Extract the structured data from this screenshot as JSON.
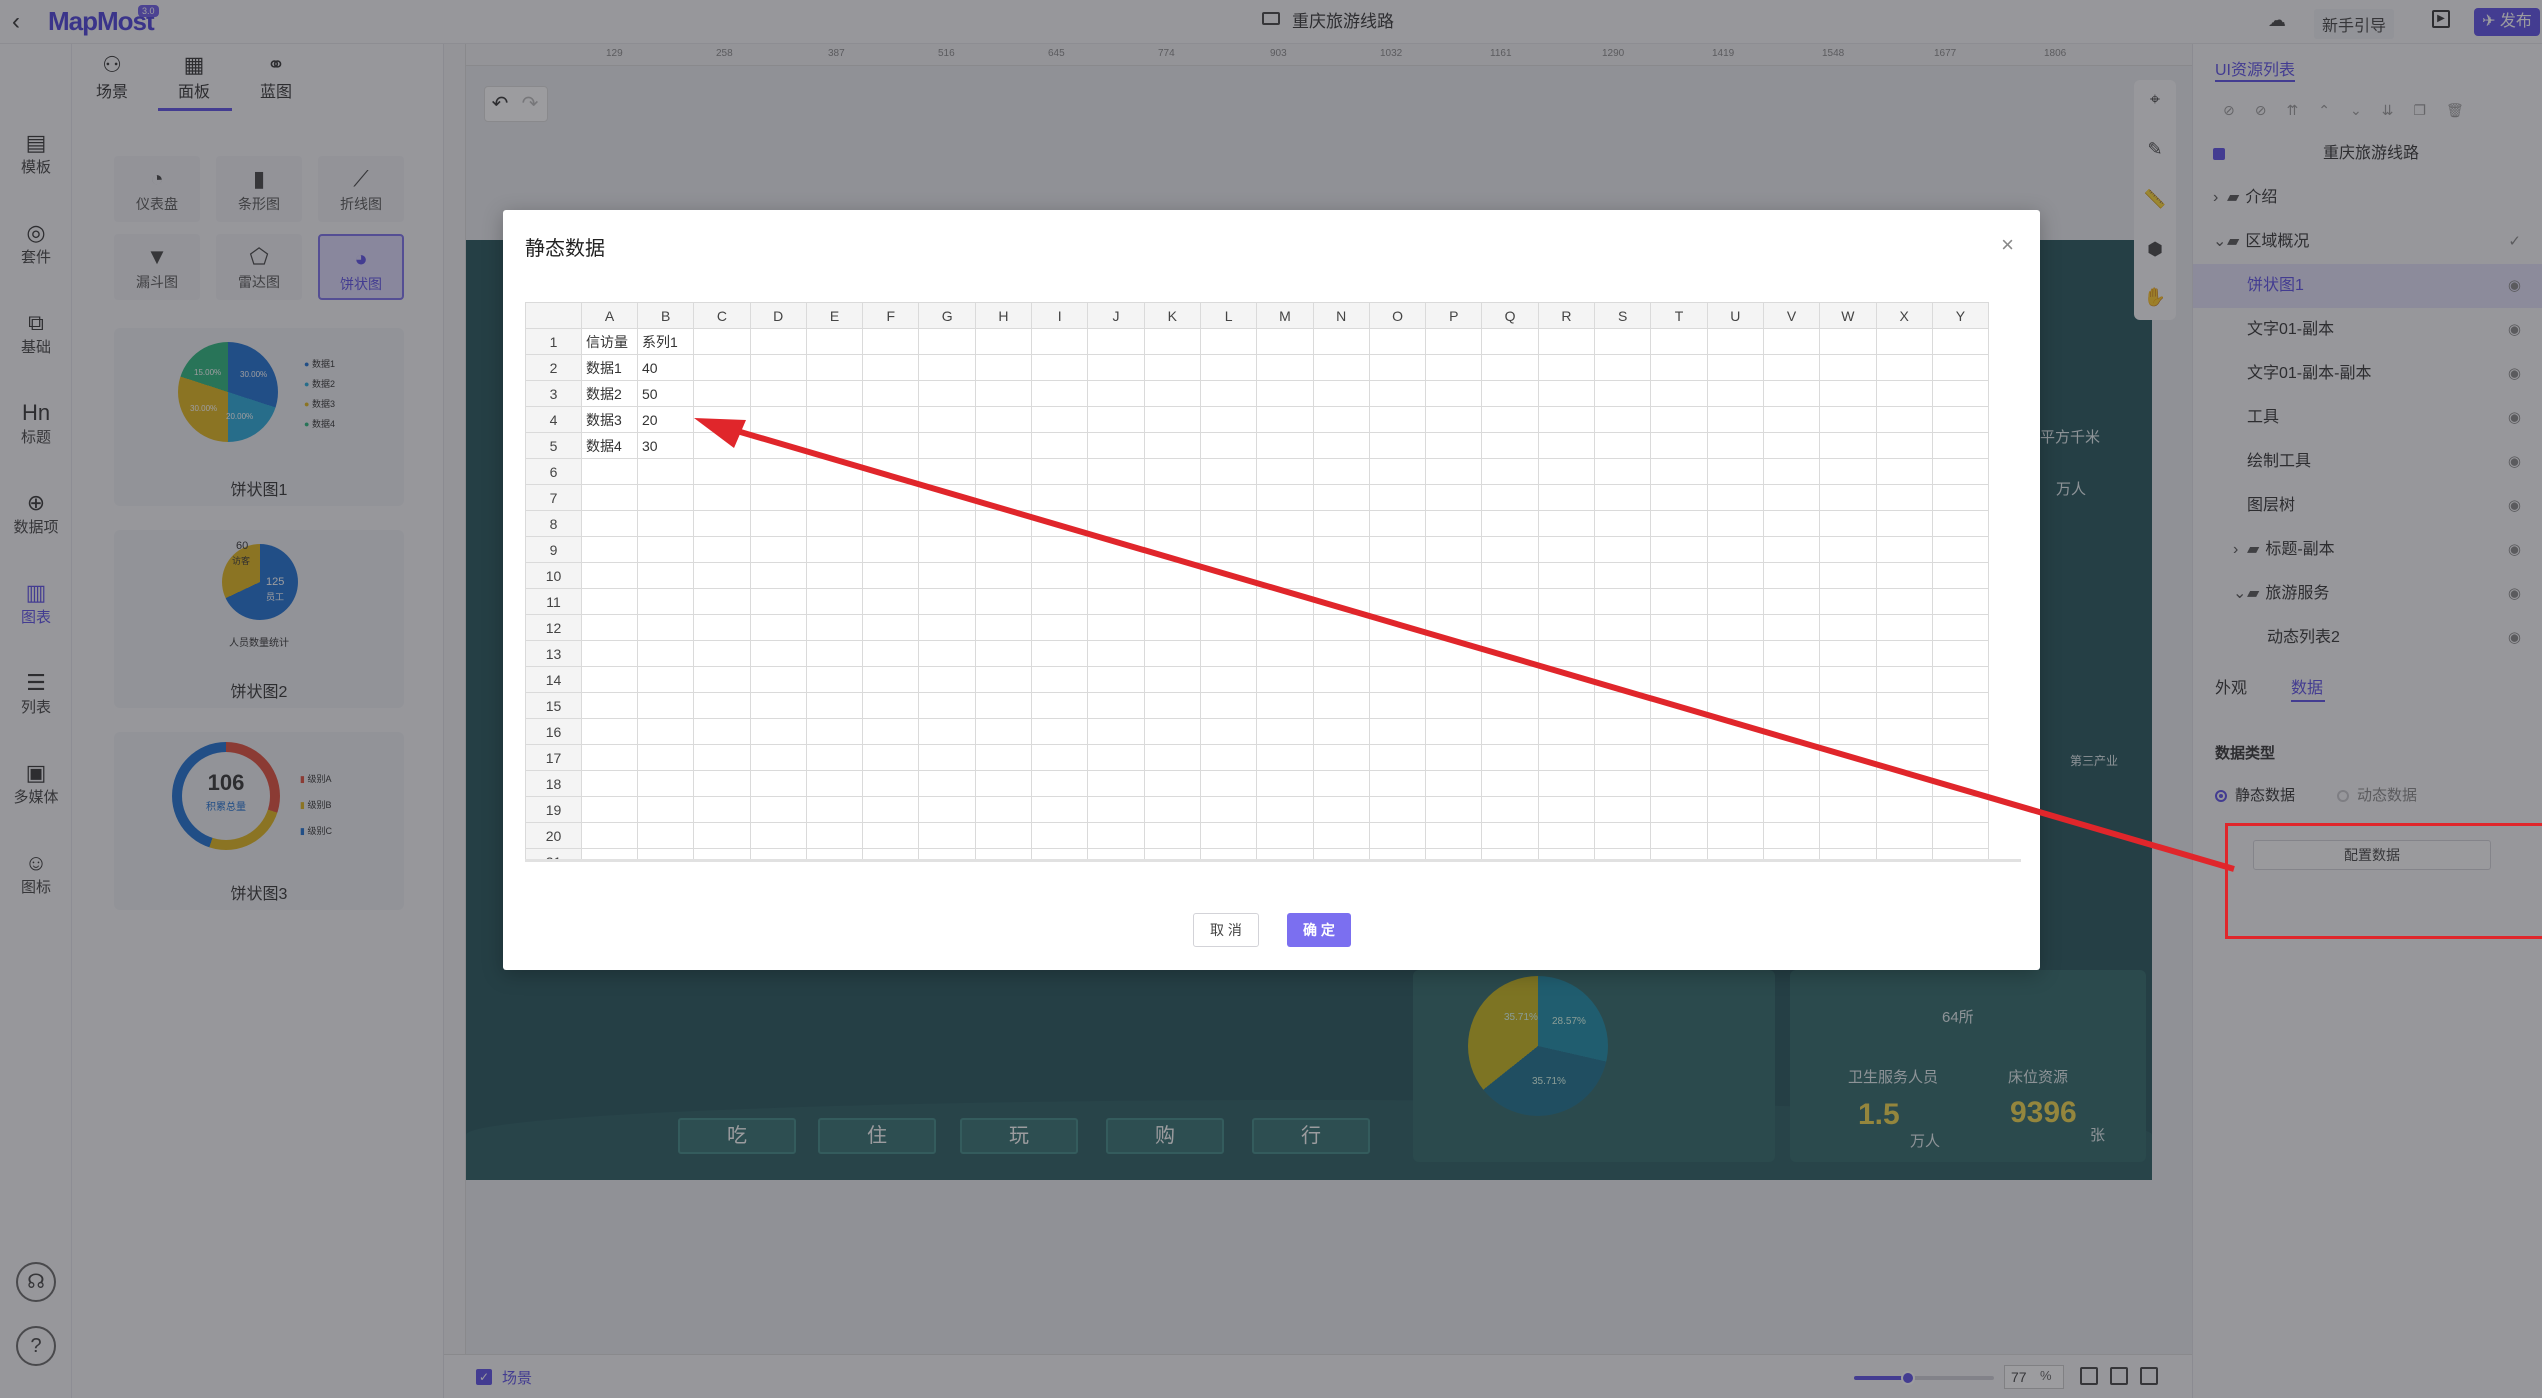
{
  "app": {
    "logo": "MapMost",
    "badge": "3.0",
    "title": "重庆旅游线路",
    "guide": "新手引导",
    "publish": "发布"
  },
  "leftnav": [
    {
      "label": "模板",
      "icon": "template-icon"
    },
    {
      "label": "套件",
      "icon": "kit-icon"
    },
    {
      "label": "基础",
      "icon": "basic-icon"
    },
    {
      "label": "标题",
      "icon": "title-icon"
    },
    {
      "label": "数据项",
      "icon": "data-item-icon"
    },
    {
      "label": "图表",
      "icon": "chart-icon"
    },
    {
      "label": "列表",
      "icon": "list-icon"
    },
    {
      "label": "多媒体",
      "icon": "media-icon"
    },
    {
      "label": "图标",
      "icon": "smile-icon"
    }
  ],
  "library": {
    "tabs": [
      "场景",
      "面板",
      "蓝图"
    ],
    "types": [
      "仪表盘",
      "条形图",
      "折线图",
      "漏斗图",
      "雷达图",
      "饼状图"
    ],
    "cards": [
      {
        "label": "饼状图1",
        "slices": [
          "30.00%",
          "20.00%",
          "30.00%",
          "15.00%"
        ],
        "legend": [
          "数据1",
          "数据2",
          "数据3",
          "数据4"
        ]
      },
      {
        "label": "饼状图2",
        "values": [
          "60",
          "125"
        ],
        "sub": [
          "访客",
          "员工"
        ],
        "caption": "人员数量统计"
      },
      {
        "label": "饼状图3",
        "value": "106",
        "sub": "积累总量",
        "legend": [
          "级别A",
          "级别B",
          "级别C"
        ]
      }
    ]
  },
  "ruler": {
    "h": [
      "129",
      "258",
      "387",
      "516",
      "645",
      "774",
      "903",
      "1032",
      "1161",
      "1290",
      "1419",
      "1548",
      "1677",
      "1806"
    ],
    "v": [
      "129",
      "258",
      "387",
      "516",
      "645",
      "774",
      "903",
      "1032",
      "1161",
      "1290"
    ]
  },
  "map": {
    "buttons": [
      "吃",
      "住",
      "玩",
      "购",
      "行"
    ],
    "pie_labels": [
      "28.57%",
      "35.71%",
      "35.71%"
    ],
    "side_labels": [
      "平方千米",
      "万人",
      "第三产业"
    ],
    "stats": [
      {
        "label": "卫生服务人员",
        "value": "1.5",
        "unit": "万人"
      },
      {
        "label": "床位资源",
        "value": "9396",
        "unit": "张"
      }
    ],
    "count": "64所"
  },
  "dialog": {
    "title": "静态数据",
    "columns": [
      "A",
      "B",
      "C",
      "D",
      "E",
      "F",
      "G",
      "H",
      "I",
      "J",
      "K",
      "L",
      "M",
      "N",
      "O",
      "P",
      "Q",
      "R",
      "S",
      "T",
      "U",
      "V",
      "W",
      "X",
      "Y"
    ],
    "rows": [
      [
        "信访量",
        "系列1"
      ],
      [
        "数据1",
        "40"
      ],
      [
        "数据2",
        "50"
      ],
      [
        "数据3",
        "20"
      ],
      [
        "数据4",
        "30"
      ]
    ],
    "row_count": 21,
    "cancel": "取 消",
    "confirm": "确 定"
  },
  "rightpanel": {
    "title": "UI资源列表",
    "root": "重庆旅游线路",
    "tree": [
      {
        "label": "介绍",
        "depth": 0,
        "toggle": "›",
        "folder": true
      },
      {
        "label": "区域概况",
        "depth": 0,
        "toggle": "⌄",
        "folder": true
      },
      {
        "label": "饼状图1",
        "depth": 1,
        "selected": true
      },
      {
        "label": "文字01-副本",
        "depth": 1
      },
      {
        "label": "文字01-副本-副本",
        "depth": 1
      },
      {
        "label": "工具",
        "depth": 1
      },
      {
        "label": "绘制工具",
        "depth": 1
      },
      {
        "label": "图层树",
        "depth": 1
      },
      {
        "label": "标题-副本",
        "depth": 1,
        "toggle": "›",
        "folder": true
      },
      {
        "label": "旅游服务",
        "depth": 1,
        "toggle": "⌄",
        "folder": true
      },
      {
        "label": "动态列表2",
        "depth": 2
      }
    ],
    "prop_tabs": [
      "外观",
      "数据"
    ],
    "data_type_label": "数据类型",
    "static": "静态数据",
    "dynamic": "动态数据",
    "config": "配置数据"
  },
  "bottom": {
    "scene": "场景",
    "zoom": "77",
    "zoom_fraction": 0.77,
    "pct": "%"
  }
}
